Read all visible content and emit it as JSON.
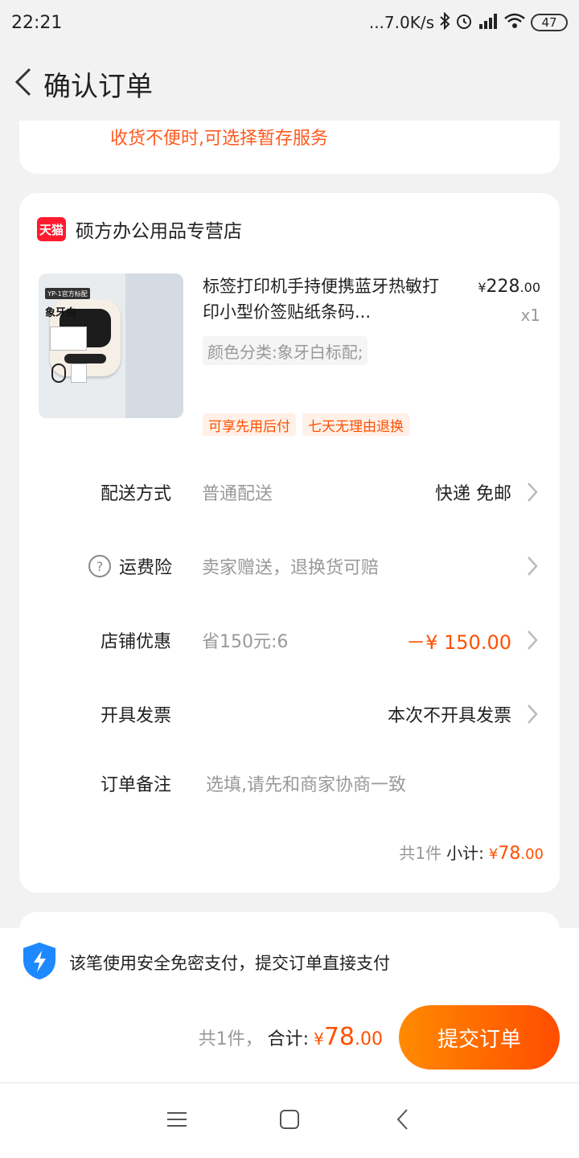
{
  "status_bar": {
    "time": "22:21",
    "network_speed": "...7.0K/s",
    "battery": "47",
    "icons": [
      "bluetooth-icon",
      "alarm-icon",
      "signal-icon",
      "wifi-icon",
      "battery-icon"
    ]
  },
  "header": {
    "title": "确认订单",
    "back_icon": "chevron-left-icon"
  },
  "top_notice": "收货不便时,可选择暂存服务",
  "shop": {
    "badge": "天猫",
    "name": "硕方办公用品专营店"
  },
  "product": {
    "title": "标签打印机手持便携蓝牙热敏打印小型价签贴纸条码...",
    "price_symbol": "¥",
    "price_int": "228",
    "price_dec": ".00",
    "quantity": "x1",
    "spec": "颜色分类:象牙白标配;",
    "image_tag": "YP-1官方标配",
    "image_color": "象牙白",
    "tags": [
      "可享先用后付",
      "七天无理由退换"
    ]
  },
  "rows": {
    "delivery": {
      "label": "配送方式",
      "value": "普通配送",
      "right": "快递 免邮"
    },
    "insurance": {
      "label": "运费险",
      "value": "卖家赠送，退换货可赔"
    },
    "discount": {
      "label": "店铺优惠",
      "value": "省150元:6",
      "right": "－¥ 150.00"
    },
    "invoice": {
      "label": "开具发票",
      "right": "本次不开具发票"
    },
    "remark": {
      "label": "订单备注",
      "placeholder": "选填,请先和商家协商一致"
    }
  },
  "subtotal": {
    "count": "共1件",
    "label": "小计:",
    "symbol": "¥",
    "int": "78",
    "dec": ".00"
  },
  "bottom": {
    "secure_text": "该笔使用安全免密支付，提交订单直接支付",
    "count": "共1件，",
    "total_label": "合计:",
    "symbol": "¥",
    "int": "78",
    "dec": ".00",
    "submit": "提交订单"
  },
  "colors": {
    "accent": "#ff5000",
    "notice": "#ff5a1f",
    "tmall": "#ff1b2d",
    "shield": "#1e88ff"
  }
}
